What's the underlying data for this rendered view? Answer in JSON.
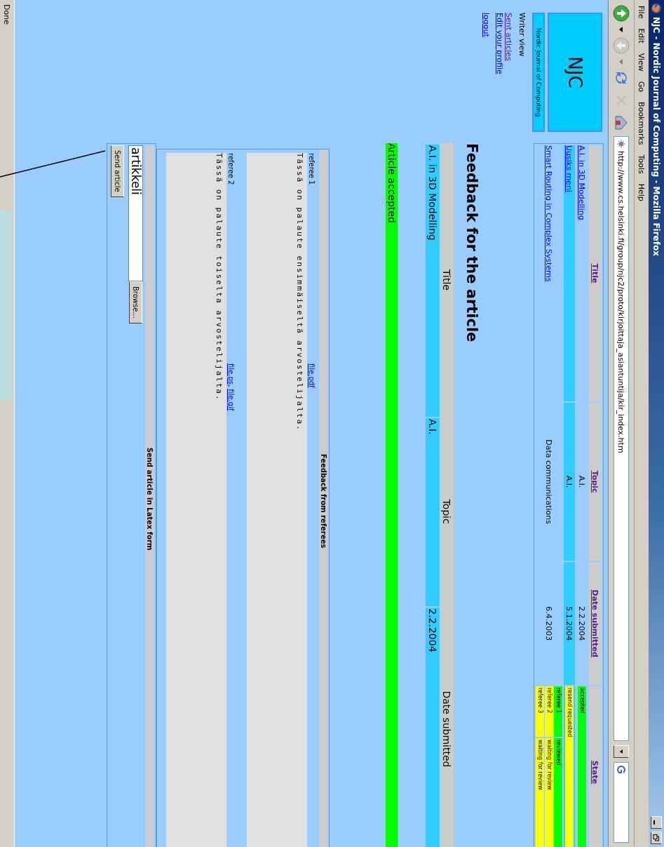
{
  "window": {
    "title": "NJC - Nordic Journal of Computing - Mozilla Firefox"
  },
  "menu": [
    "File",
    "Edit",
    "View",
    "Go",
    "Bookmarks",
    "Tools",
    "Help"
  ],
  "address_bar": {
    "value": "http://www.cs.helsinki.fi/group/njc2/proto/kirjoittaja_asiantuntija/kir_index.htm"
  },
  "sidebar": {
    "logo": "NJC",
    "subtitle": "Nordic Journal of Computing",
    "view_label": "Writer view",
    "links": [
      {
        "label": "Sent articles",
        "visited": true
      },
      {
        "label": "Edit your profile",
        "visited": false
      },
      {
        "label": "logout",
        "visited": false
      }
    ]
  },
  "articles_table": {
    "columns": [
      "Title",
      "Topic",
      "Date submitted",
      "State"
    ],
    "rows": [
      {
        "title": "A.I. in 3D Modelling",
        "topic": "A.I.",
        "date": "2.2.2004",
        "selected": false,
        "states": [
          {
            "kind": "overall",
            "label": "accepted",
            "color": "#00ff00"
          }
        ]
      },
      {
        "title": "Uusiks meni",
        "topic": "A.I.",
        "date": "5.1.2004",
        "selected": true,
        "states": [
          {
            "kind": "overall",
            "label": "resend requested",
            "color": "#ffff00"
          }
        ]
      },
      {
        "title": "Smart Routing in Complex Systems",
        "topic": "Data communications",
        "date": "6.4.2003",
        "selected": false,
        "states": [
          {
            "kind": "referee",
            "label": "referee 1",
            "status": "reviewed",
            "color": "#00ff00"
          },
          {
            "kind": "referee",
            "label": "referee 2",
            "status": "waiting for review",
            "color": "#ffff00"
          },
          {
            "kind": "referee",
            "label": "referee 3",
            "status": "waiting for review",
            "color": "#ffff00"
          }
        ]
      }
    ]
  },
  "feedback": {
    "heading": "Feedback for the article",
    "columns": [
      "Title",
      "Topic",
      "Date submitted"
    ],
    "row": [
      "A.I. in 3D Modelling",
      "A.I.",
      "2.2.2004"
    ],
    "status": {
      "label": "Article accepted",
      "color": "#00ff00"
    }
  },
  "referee_feedback": {
    "title": "Feedback from referees",
    "separator": ",",
    "items": [
      {
        "referee": "referee 1",
        "files": [
          "file.pdf"
        ],
        "text": "Tässä on palaute ensimmäiseltä arvostelijalta."
      },
      {
        "referee": "referee 2",
        "files": [
          "file.ps",
          "file.gif"
        ],
        "text": "Tässä on palaute toiselta arvostelijalta."
      }
    ]
  },
  "upload": {
    "title": "Send article in Latex form",
    "file_value": "artikkeli",
    "browse_label": "Browse...",
    "submit_label": "Send article"
  },
  "status_bar": {
    "text": "Done"
  }
}
